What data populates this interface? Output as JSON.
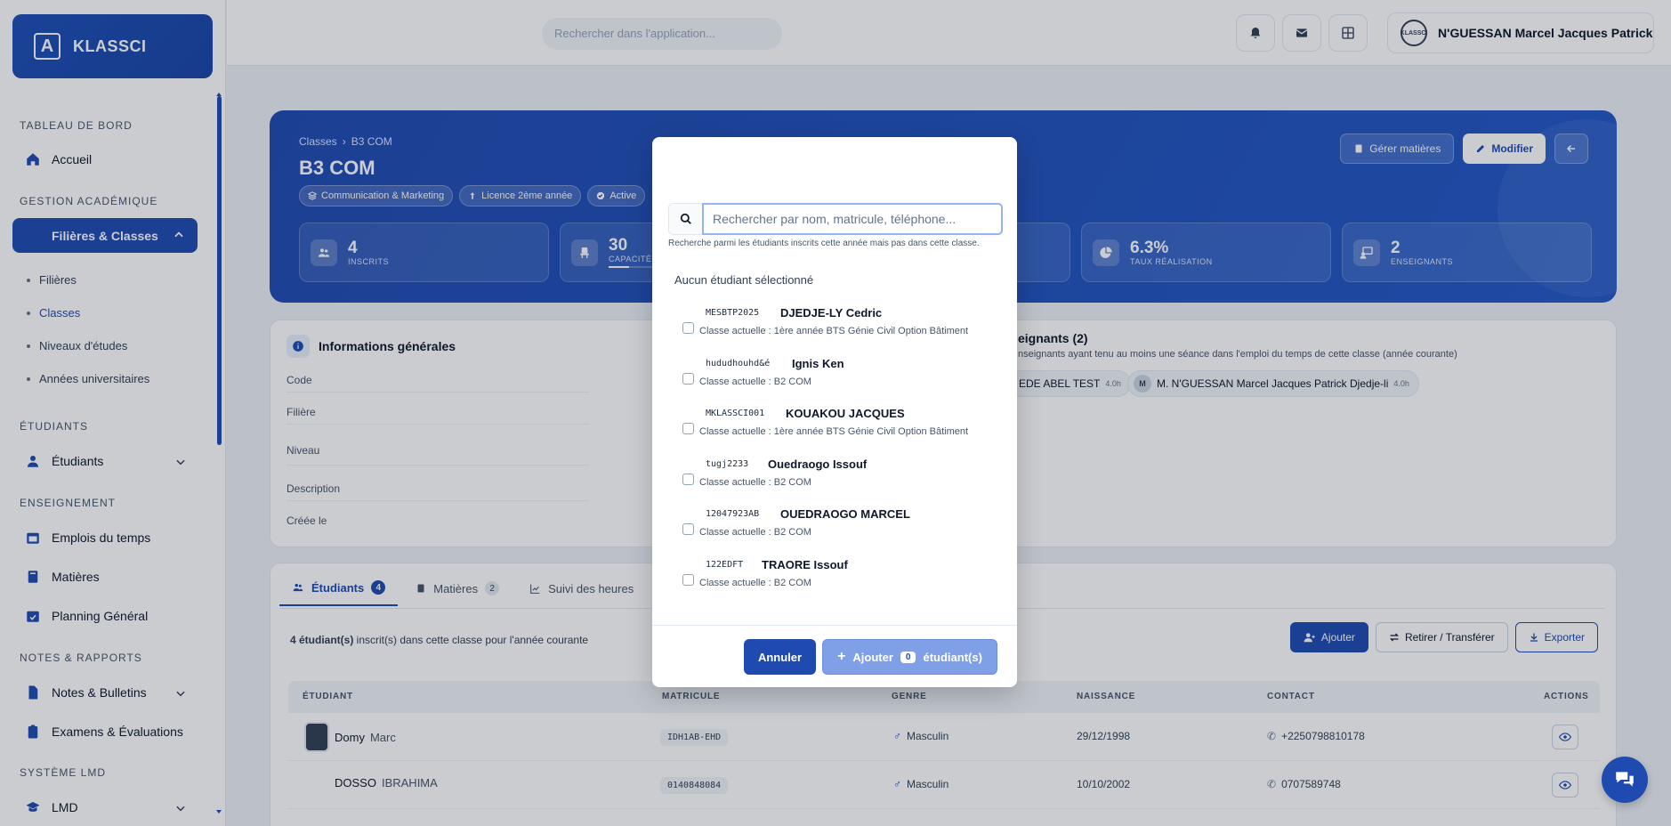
{
  "app": {
    "name": "KLASSCI",
    "logo_letter": "A"
  },
  "sidebar": {
    "sections": {
      "dashboard": "TABLEAU DE BORD",
      "academic": "GESTION ACADÉMIQUE",
      "students": "ÉTUDIANTS",
      "teaching": "ENSEIGNEMENT",
      "notes": "NOTES & RAPPORTS",
      "lmd": "SYSTÈME LMD"
    },
    "items": {
      "home": "Accueil",
      "filieres_classes": "Filières & Classes",
      "filieres": "Filières",
      "classes": "Classes",
      "niveaux": "Niveaux d'études",
      "annees": "Années universitaires",
      "etudiants": "Étudiants",
      "emplois": "Emplois du temps",
      "matieres": "Matières",
      "planning": "Planning Général",
      "notes_bulletins": "Notes & Bulletins",
      "examens": "Examens & Évaluations",
      "lmd": "LMD"
    }
  },
  "topbar": {
    "search_placeholder": "Rechercher dans l'application...",
    "user_name": "N'GUESSAN Marcel Jacques Patrick",
    "user_avatar_text": "KLASSCI"
  },
  "hero": {
    "breadcrumb": {
      "root": "Classes",
      "sep": "›",
      "current": "B3 COM"
    },
    "title": "B3 COM",
    "tags": [
      "Communication & Marketing",
      "Licence 2ème année",
      "Active"
    ],
    "buttons": {
      "manage": "Gérer matières",
      "edit": "Modifier"
    },
    "stats": [
      {
        "value": "4",
        "label": "INSCRITS"
      },
      {
        "value": "30",
        "label": "CAPACITÉ"
      },
      {
        "value": "",
        "label": ""
      },
      {
        "value": "6.3%",
        "label": "TAUX RÉALISATION"
      },
      {
        "value": "2",
        "label": "ENSEIGNANTS"
      }
    ]
  },
  "info": {
    "title": "Informations générales",
    "rows": [
      "Code",
      "Filière",
      "Niveau",
      "Description",
      "Créée le"
    ]
  },
  "teachers": {
    "title": "eignants (2)",
    "subtitle": "nseignants ayant tenu au moins une séance dans l'emploi du temps de cette classe (année courante)",
    "chips": [
      {
        "initial": "",
        "name": "EDE ABEL TEST",
        "hours": "4.0h"
      },
      {
        "initial": "M",
        "name": "M. N'GUESSAN Marcel Jacques Patrick Djedje-li",
        "hours": "4.0h"
      }
    ]
  },
  "tabs": {
    "students": {
      "label": "Étudiants",
      "count": "4"
    },
    "subjects": {
      "label": "Matières",
      "count": "2"
    },
    "hours": {
      "label": "Suivi des heures"
    }
  },
  "table": {
    "count_bold": "4 étudiant(s)",
    "count_rest": " inscrit(s) dans cette classe pour l'année courante",
    "actions": {
      "add": "Ajouter",
      "transfer": "Retirer / Transférer",
      "export": "Exporter"
    },
    "headers": {
      "student": "ÉTUDIANT",
      "matricule": "MATRICULE",
      "genre": "GENRE",
      "naissance": "NAISSANCE",
      "contact": "CONTACT",
      "actions": "ACTIONS"
    },
    "rows": [
      {
        "last": "Domy",
        "first": "Marc",
        "matricule": "IDH1AB-EHD",
        "genre": "Masculin",
        "naissance": "29/12/1998",
        "contact": "+2250798810178"
      },
      {
        "last": "DOSSO",
        "first": "IBRAHIMA",
        "matricule": "0140848084",
        "genre": "Masculin",
        "naissance": "10/10/2002",
        "contact": "0707589748"
      }
    ]
  },
  "modal": {
    "search_placeholder": "Rechercher par nom, matricule, téléphone...",
    "search_hint": "Recherche parmi les étudiants inscrits cette année mais pas dans cette classe.",
    "selection_status": "Aucun étudiant sélectionné",
    "students": [
      {
        "matricule": "MESBTP2025",
        "name": "DJEDJE-LY Cedric",
        "class": "Classe actuelle : 1ère année BTS Génie Civil Option Bâtiment"
      },
      {
        "matricule": "hududhouhd&é",
        "name": "Ignis Ken",
        "class": "Classe actuelle : B2 COM"
      },
      {
        "matricule": "MKLASSCI001",
        "name": "KOUAKOU JACQUES",
        "class": "Classe actuelle : 1ère année BTS Génie Civil Option Bâtiment"
      },
      {
        "matricule": "tugj2233",
        "name": "Ouedraogo Issouf",
        "class": "Classe actuelle : B2 COM"
      },
      {
        "matricule": "12047923AB",
        "name": "OUEDRAOGO MARCEL",
        "class": "Classe actuelle : B2 COM"
      },
      {
        "matricule": "122EDFT",
        "name": "TRAORE Issouf",
        "class": "Classe actuelle : B2 COM"
      }
    ],
    "cancel_label": "Annuler",
    "add_label_prefix": "Ajouter",
    "add_count": "0",
    "add_label_suffix": "étudiant(s)"
  },
  "colors": {
    "primary": "#1f4bb1",
    "primary_light": "#7fa0e6",
    "background": "#eef1f6"
  }
}
